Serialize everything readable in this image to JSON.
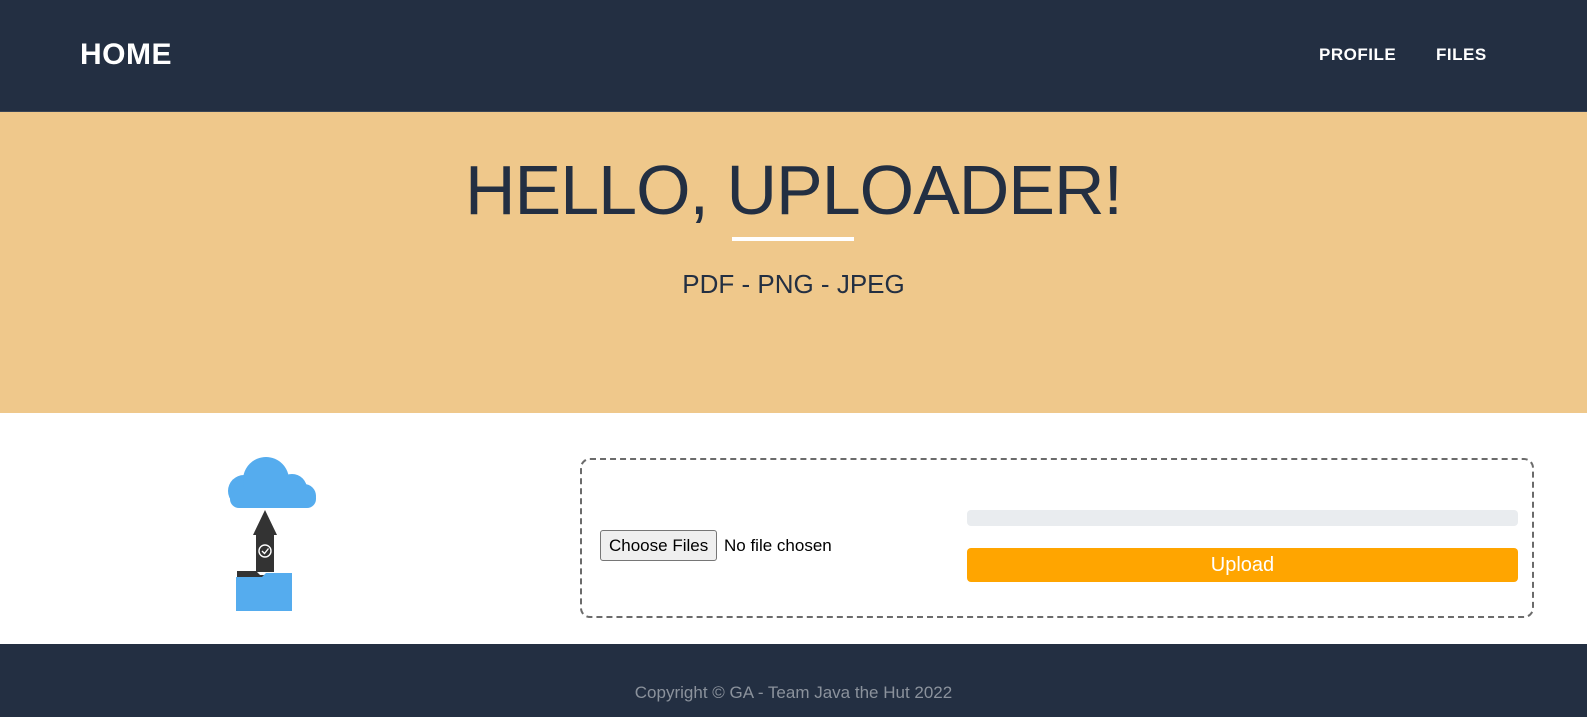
{
  "navbar": {
    "brand": "HOME",
    "links": [
      {
        "label": "PROFILE"
      },
      {
        "label": "FILES"
      }
    ]
  },
  "hero": {
    "title": "HELLO, UPLOADER!",
    "subtitle": "PDF - PNG - JPEG"
  },
  "upload": {
    "illustration_icon": "cloud-upload-folder-icon",
    "file_input": {
      "button_label": "Choose Files",
      "status": "No file chosen"
    },
    "progress": {
      "value_percent": 0
    },
    "submit_label": "Upload"
  },
  "footer": {
    "copyright": "Copyright © GA - Team Java the Hut 2022"
  },
  "colors": {
    "navbar_bg": "#232f42",
    "hero_bg": "#efc88b",
    "accent": "#ffa500",
    "icon_blue": "#55acee",
    "footer_text": "#8b929c"
  }
}
